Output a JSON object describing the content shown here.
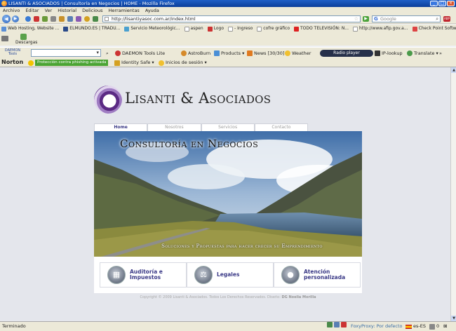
{
  "window": {
    "title": "LISANTI & ASOCIADOS | Consultoría en Negocios | HOME - Mozilla Firefox",
    "controls": [
      "_",
      "□",
      "×"
    ]
  },
  "menu": [
    "Archivo",
    "Editar",
    "Ver",
    "Historial",
    "Delicious",
    "Herramientas",
    "Ayuda"
  ],
  "navigation": {
    "url": "http://lisantiyasoc.com.ar/index.html",
    "search_placeholder": "Google"
  },
  "bookmarks": [
    "Web Hosting, Website ...",
    "ELMUNDO.ES | TRADU...",
    "Servicio Meteorológic...",
    "aspen",
    "Logo",
    "- Ingreso",
    "cofre gráfico",
    "TODO TELEVISIÓN: N...",
    "http://www.afip.gov.a...",
    "Check Point Software: ..."
  ],
  "downloads": {
    "label": "Descargas"
  },
  "daemon_toolbar": {
    "logo_line1": "DAEMON",
    "logo_line2": "Tools",
    "items": [
      "DAEMON Tools Lite",
      "AstroBurn",
      "Products",
      "News [30/30]",
      "Weather",
      "IP-lookup",
      "Translate"
    ],
    "radio_player": "Radio player"
  },
  "norton_toolbar": {
    "logo": "Norton",
    "phishing_badge": "Protección contra phishing activada",
    "identity": "Identity Safe",
    "login": "Inicios de sesión"
  },
  "site": {
    "brand": "Lisanti & Asociados",
    "tabs": [
      "Home",
      "Nosotros",
      "Servicios",
      "Contacto"
    ],
    "hero_title": "Consultoría en Negocios",
    "hero_subtitle": "Soluciones y Propuestas para hacer crecer su Emprendimiento",
    "services": [
      {
        "line1": "Auditoría e",
        "line2": "Impuestos",
        "icon": "calculator"
      },
      {
        "line1": "Legales",
        "line2": "",
        "icon": "scales"
      },
      {
        "line1": "Atención",
        "line2": "personalizada",
        "icon": "person"
      }
    ],
    "footer_text": "Copyright © 2009 Lisanti & Asociados. Todos Los Derechos Reservados. Diseño:",
    "footer_designer": "DG Noelia Morilla"
  },
  "status": {
    "left": "Terminado",
    "foxyproxy": "FoxyProxy: Por defecto",
    "locale": "es-ES",
    "count": "0"
  },
  "colors": {
    "titlebar": "#0b3e9a",
    "chrome": "#ece9d8",
    "brand_purple": "#3b3a87"
  }
}
